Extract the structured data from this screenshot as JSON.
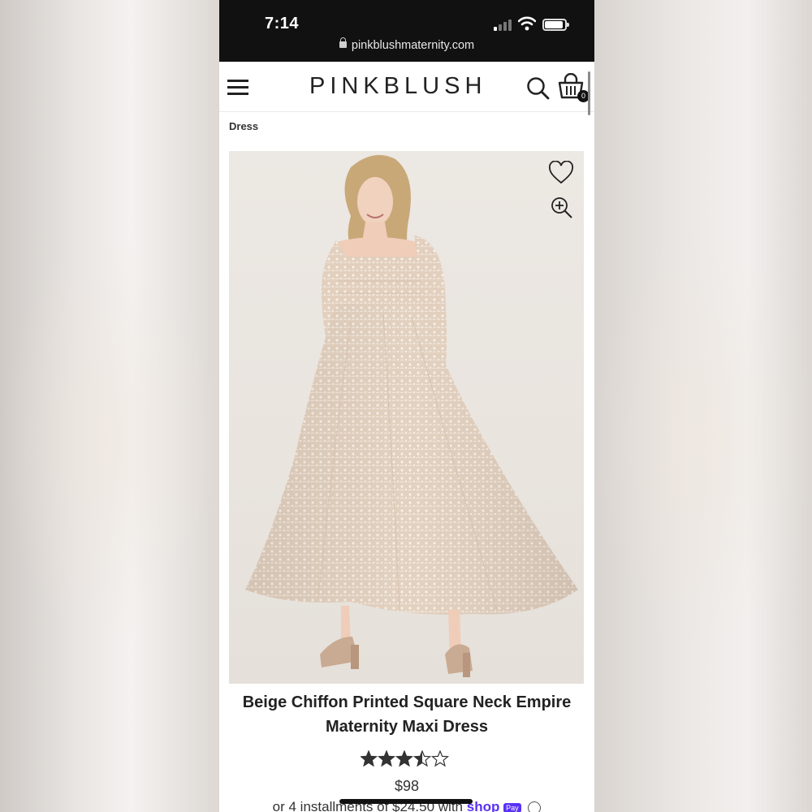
{
  "status_bar": {
    "time": "7:14",
    "url": "pinkblushmaternity.com"
  },
  "header": {
    "logo": "PINKBLUSH",
    "cart_count": "0",
    "menu_icon": "hamburger-menu-icon",
    "search_icon": "search-icon",
    "cart_icon": "shopping-bag-icon"
  },
  "breadcrumb": {
    "last": "Dress"
  },
  "product": {
    "title": "Beige Chiffon Printed Square Neck Empire Maternity Maxi Dress",
    "rating": 3.5,
    "rating_max": 5,
    "price": "$98",
    "installments_text": "or 4 installments of $24.50 with",
    "shop_pay_label": "shop",
    "pay_badge": "Pay",
    "wishlist_icon": "heart-icon",
    "zoom_icon": "zoom-in-icon",
    "dress_color": "#e6d5c4"
  }
}
